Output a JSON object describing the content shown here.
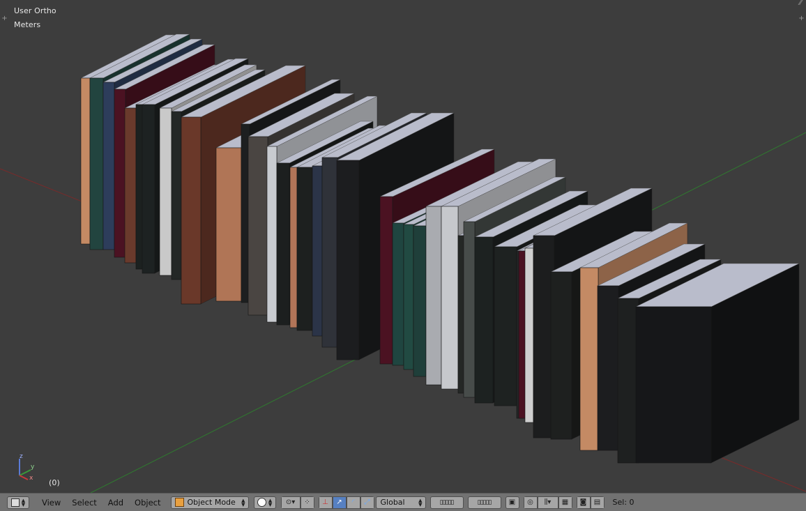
{
  "viewport": {
    "view_name": "User Ortho",
    "units": "Meters",
    "frame": "(0)",
    "axis_labels": {
      "z": "z",
      "y": "y",
      "x": "x"
    }
  },
  "header": {
    "menus": [
      "View",
      "Select",
      "Add",
      "Object"
    ],
    "mode": "Object Mode",
    "orientation": "Global",
    "selection": "Sel: 0"
  },
  "colors": {
    "background": "#3d3d3d",
    "header": "#727272",
    "x_axis": "#7a2a2a",
    "y_axis": "#2f7a2f",
    "active_button": "#5680c2"
  }
}
